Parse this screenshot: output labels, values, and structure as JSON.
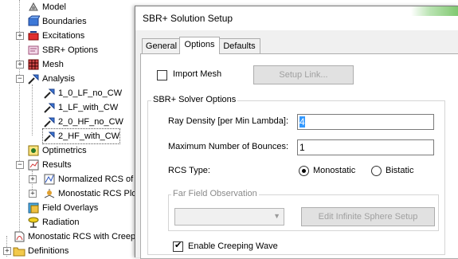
{
  "tree": {
    "items": [
      {
        "label": "Model",
        "icon": "model-icon"
      },
      {
        "label": "Boundaries",
        "icon": "boundaries-icon"
      },
      {
        "label": "Excitations",
        "icon": "excitations-icon"
      },
      {
        "label": "SBR+ Options",
        "icon": "sbr-options-icon"
      },
      {
        "label": "Mesh",
        "icon": "mesh-icon"
      },
      {
        "label": "Analysis",
        "icon": "analysis-icon"
      },
      {
        "label": "1_0_LF_no_CW",
        "icon": "setup-icon"
      },
      {
        "label": "1_LF_with_CW",
        "icon": "setup-icon"
      },
      {
        "label": "2_0_HF_no_CW",
        "icon": "setup-icon"
      },
      {
        "label": "2_HF_with_CW",
        "icon": "setup-icon"
      },
      {
        "label": "Optimetrics",
        "icon": "optimetrics-icon"
      },
      {
        "label": "Results",
        "icon": "results-icon"
      },
      {
        "label": "Normalized RCS of a",
        "icon": "plot-icon"
      },
      {
        "label": "Monostatic RCS Plo",
        "icon": "plot3d-icon"
      },
      {
        "label": "Field Overlays",
        "icon": "field-overlays-icon"
      },
      {
        "label": "Radiation",
        "icon": "radiation-icon"
      },
      {
        "label": "Monostatic RCS with Creepi",
        "icon": "design-icon"
      },
      {
        "label": "Definitions",
        "icon": "folder-icon"
      }
    ]
  },
  "dialog": {
    "title": "SBR+ Solution Setup",
    "tabs": [
      "General",
      "Options",
      "Defaults"
    ],
    "active_tab": "Options",
    "import_mesh_label": "Import Mesh",
    "import_mesh_checked": false,
    "setup_link_label": "Setup Link...",
    "solver_group_title": "SBR+ Solver Options",
    "ray_density_label": "Ray Density [per Min Lambda]:",
    "ray_density_value": "4",
    "max_bounces_label": "Maximum Number of Bounces:",
    "max_bounces_value": "1",
    "rcs_type_label": "RCS Type:",
    "rcs_options": [
      "Monostatic",
      "Bistatic"
    ],
    "rcs_selected": "Monostatic",
    "far_field_group_title": "Far Field Observation",
    "edit_sphere_label": "Edit Infinite Sphere Setup",
    "creeping_wave_label": "Enable Creeping Wave",
    "creeping_wave_checked": true
  },
  "colors": {
    "dialog_bg": "#f0f0f0",
    "panel_bg": "#ffffff",
    "disabled_text": "#a0a0a0",
    "selection_highlight": "#3399ff"
  }
}
